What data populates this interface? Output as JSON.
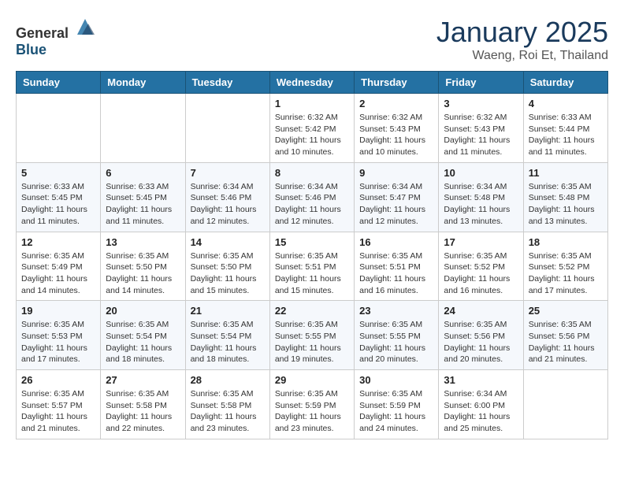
{
  "header": {
    "logo_general": "General",
    "logo_blue": "Blue",
    "month": "January 2025",
    "location": "Waeng, Roi Et, Thailand"
  },
  "weekdays": [
    "Sunday",
    "Monday",
    "Tuesday",
    "Wednesday",
    "Thursday",
    "Friday",
    "Saturday"
  ],
  "weeks": [
    [
      {
        "day": "",
        "info": ""
      },
      {
        "day": "",
        "info": ""
      },
      {
        "day": "",
        "info": ""
      },
      {
        "day": "1",
        "info": "Sunrise: 6:32 AM\nSunset: 5:42 PM\nDaylight: 11 hours\nand 10 minutes."
      },
      {
        "day": "2",
        "info": "Sunrise: 6:32 AM\nSunset: 5:43 PM\nDaylight: 11 hours\nand 10 minutes."
      },
      {
        "day": "3",
        "info": "Sunrise: 6:32 AM\nSunset: 5:43 PM\nDaylight: 11 hours\nand 11 minutes."
      },
      {
        "day": "4",
        "info": "Sunrise: 6:33 AM\nSunset: 5:44 PM\nDaylight: 11 hours\nand 11 minutes."
      }
    ],
    [
      {
        "day": "5",
        "info": "Sunrise: 6:33 AM\nSunset: 5:45 PM\nDaylight: 11 hours\nand 11 minutes."
      },
      {
        "day": "6",
        "info": "Sunrise: 6:33 AM\nSunset: 5:45 PM\nDaylight: 11 hours\nand 11 minutes."
      },
      {
        "day": "7",
        "info": "Sunrise: 6:34 AM\nSunset: 5:46 PM\nDaylight: 11 hours\nand 12 minutes."
      },
      {
        "day": "8",
        "info": "Sunrise: 6:34 AM\nSunset: 5:46 PM\nDaylight: 11 hours\nand 12 minutes."
      },
      {
        "day": "9",
        "info": "Sunrise: 6:34 AM\nSunset: 5:47 PM\nDaylight: 11 hours\nand 12 minutes."
      },
      {
        "day": "10",
        "info": "Sunrise: 6:34 AM\nSunset: 5:48 PM\nDaylight: 11 hours\nand 13 minutes."
      },
      {
        "day": "11",
        "info": "Sunrise: 6:35 AM\nSunset: 5:48 PM\nDaylight: 11 hours\nand 13 minutes."
      }
    ],
    [
      {
        "day": "12",
        "info": "Sunrise: 6:35 AM\nSunset: 5:49 PM\nDaylight: 11 hours\nand 14 minutes."
      },
      {
        "day": "13",
        "info": "Sunrise: 6:35 AM\nSunset: 5:50 PM\nDaylight: 11 hours\nand 14 minutes."
      },
      {
        "day": "14",
        "info": "Sunrise: 6:35 AM\nSunset: 5:50 PM\nDaylight: 11 hours\nand 15 minutes."
      },
      {
        "day": "15",
        "info": "Sunrise: 6:35 AM\nSunset: 5:51 PM\nDaylight: 11 hours\nand 15 minutes."
      },
      {
        "day": "16",
        "info": "Sunrise: 6:35 AM\nSunset: 5:51 PM\nDaylight: 11 hours\nand 16 minutes."
      },
      {
        "day": "17",
        "info": "Sunrise: 6:35 AM\nSunset: 5:52 PM\nDaylight: 11 hours\nand 16 minutes."
      },
      {
        "day": "18",
        "info": "Sunrise: 6:35 AM\nSunset: 5:52 PM\nDaylight: 11 hours\nand 17 minutes."
      }
    ],
    [
      {
        "day": "19",
        "info": "Sunrise: 6:35 AM\nSunset: 5:53 PM\nDaylight: 11 hours\nand 17 minutes."
      },
      {
        "day": "20",
        "info": "Sunrise: 6:35 AM\nSunset: 5:54 PM\nDaylight: 11 hours\nand 18 minutes."
      },
      {
        "day": "21",
        "info": "Sunrise: 6:35 AM\nSunset: 5:54 PM\nDaylight: 11 hours\nand 18 minutes."
      },
      {
        "day": "22",
        "info": "Sunrise: 6:35 AM\nSunset: 5:55 PM\nDaylight: 11 hours\nand 19 minutes."
      },
      {
        "day": "23",
        "info": "Sunrise: 6:35 AM\nSunset: 5:55 PM\nDaylight: 11 hours\nand 20 minutes."
      },
      {
        "day": "24",
        "info": "Sunrise: 6:35 AM\nSunset: 5:56 PM\nDaylight: 11 hours\nand 20 minutes."
      },
      {
        "day": "25",
        "info": "Sunrise: 6:35 AM\nSunset: 5:56 PM\nDaylight: 11 hours\nand 21 minutes."
      }
    ],
    [
      {
        "day": "26",
        "info": "Sunrise: 6:35 AM\nSunset: 5:57 PM\nDaylight: 11 hours\nand 21 minutes."
      },
      {
        "day": "27",
        "info": "Sunrise: 6:35 AM\nSunset: 5:58 PM\nDaylight: 11 hours\nand 22 minutes."
      },
      {
        "day": "28",
        "info": "Sunrise: 6:35 AM\nSunset: 5:58 PM\nDaylight: 11 hours\nand 23 minutes."
      },
      {
        "day": "29",
        "info": "Sunrise: 6:35 AM\nSunset: 5:59 PM\nDaylight: 11 hours\nand 23 minutes."
      },
      {
        "day": "30",
        "info": "Sunrise: 6:35 AM\nSunset: 5:59 PM\nDaylight: 11 hours\nand 24 minutes."
      },
      {
        "day": "31",
        "info": "Sunrise: 6:34 AM\nSunset: 6:00 PM\nDaylight: 11 hours\nand 25 minutes."
      },
      {
        "day": "",
        "info": ""
      }
    ]
  ]
}
